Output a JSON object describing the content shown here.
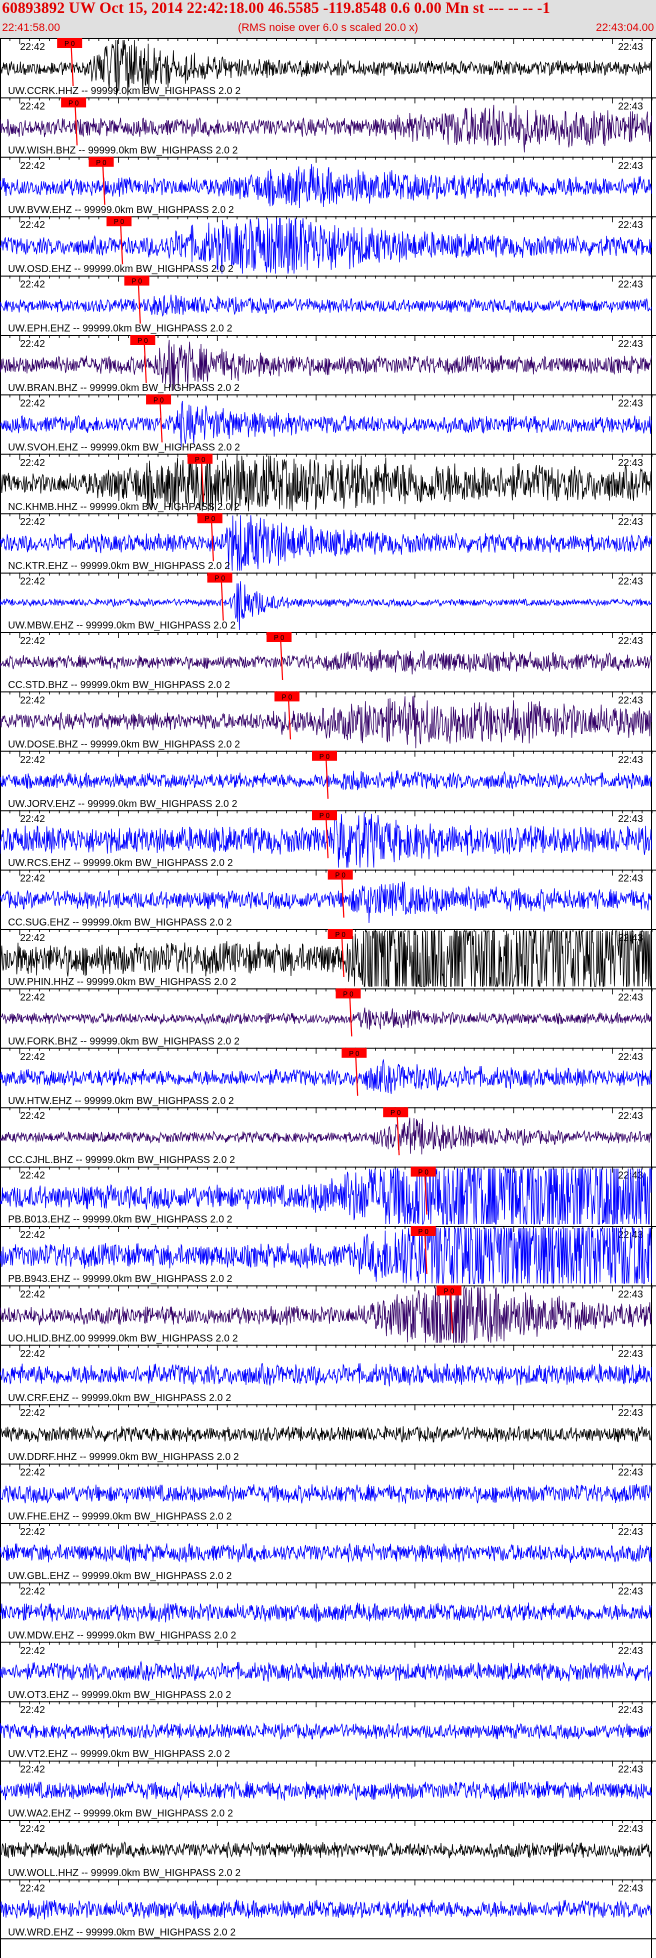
{
  "header": {
    "title": "60893892 UW Oct 15, 2014 22:42:18.00   46.5585 -119.8548  0.6 0.00 Mn st --- -- --   -1",
    "start_time": "22:41:58.00",
    "note": "(RMS noise over 6.0 s scaled 20.0 x)",
    "end_time": "22:43:04.00"
  },
  "colors": {
    "title": "#e00000",
    "header_bg": "#e0e0e0",
    "blue": "#0000ff",
    "black": "#000000",
    "indigo": "#330066",
    "pick": "#ff0000"
  },
  "chart_data": {
    "type": "line",
    "title": "60893892 UW Oct 15, 2014 22:42:18.00   46.5585 -119.8548  0.6 0.00 Mn st --- -- --   -1",
    "subtitle": "(RMS noise over 6.0 s scaled 20.0 x)",
    "x_unit": "seconds after 22:41:58.00",
    "xlim": [
      0,
      66
    ],
    "minute_labels": {
      "left": "22:42",
      "right": "22:43"
    },
    "pick_label": "P 0",
    "traces": [
      {
        "label": "UW.CCRK.HHZ -- 99999.0km BW_HIGHPASS  2.0  2",
        "color": "black",
        "pick": 7.2,
        "event_start": 8.5,
        "event_peak": 12.5,
        "event_amp": 1.0,
        "event_decay": 5.0,
        "noise": 0.25
      },
      {
        "label": "UW.WISH.BHZ -- 99999.0km BW_HIGHPASS  2.0  2",
        "color": "indigo",
        "pick": 7.6,
        "event_start": 38,
        "event_peak": 50,
        "event_amp": 0.55,
        "event_decay": 18,
        "noise": 0.3
      },
      {
        "label": "UW.BVW.EHZ -- 99999.0km BW_HIGHPASS  2.0  2",
        "color": "blue",
        "pick": 10.4,
        "event_start": 22,
        "event_peak": 30,
        "event_amp": 0.45,
        "event_decay": 14,
        "noise": 0.3
      },
      {
        "label": "UW.OSD.EHZ -- 99999.0km BW_HIGHPASS  2.0  2",
        "color": "blue",
        "pick": 12.2,
        "event_start": 14,
        "event_peak": 29,
        "event_amp": 0.95,
        "event_decay": 9,
        "noise": 0.3
      },
      {
        "label": "UW.EPH.EHZ -- 99999.0km BW_HIGHPASS  2.0  2",
        "color": "blue",
        "pick": 14.0,
        "event_start": 14.5,
        "event_peak": 16,
        "event_amp": 0.2,
        "event_decay": 6,
        "noise": 0.22
      },
      {
        "label": "UW.BRAN.BHZ -- 99999.0km BW_HIGHPASS  2.0  2",
        "color": "indigo",
        "pick": 14.6,
        "event_start": 15.5,
        "event_peak": 17,
        "event_amp": 0.75,
        "event_decay": 5,
        "noise": 0.3
      },
      {
        "label": "UW.SVOH.EHZ -- 99999.0km BW_HIGHPASS  2.0  2",
        "color": "blue",
        "pick": 16.2,
        "event_start": 17,
        "event_peak": 18.5,
        "event_amp": 0.5,
        "event_decay": 6,
        "noise": 0.28
      },
      {
        "label": "NC.KHMB.HHZ -- 99999.0km BW_HIGHPASS  2.0  2",
        "color": "black",
        "pick": 20.4,
        "event_start": 8,
        "event_peak": 22,
        "event_amp": 0.85,
        "event_decay": 30,
        "noise": 0.35
      },
      {
        "label": "NC.KTR.EHZ -- 99999.0km BW_HIGHPASS  2.0  2",
        "color": "blue",
        "pick": 21.4,
        "event_start": 22,
        "event_peak": 24,
        "event_amp": 1.0,
        "event_decay": 6,
        "noise": 0.3
      },
      {
        "label": "UW.MBW.EHZ -- 99999.0km BW_HIGHPASS  2.0  2",
        "color": "blue",
        "pick": 22.4,
        "event_start": 23.3,
        "event_peak": 24,
        "event_amp": 1.0,
        "event_decay": 2,
        "noise": 0.12
      },
      {
        "label": "CC.STD.BHZ -- 99999.0km BW_HIGHPASS  2.0  2",
        "color": "indigo",
        "pick": 28.4,
        "event_start": 30,
        "event_peak": 40,
        "event_amp": 0.2,
        "event_decay": 20,
        "noise": 0.22
      },
      {
        "label": "UW.DOSE.BHZ -- 99999.0km BW_HIGHPASS  2.0  2",
        "color": "indigo",
        "pick": 29.2,
        "event_start": 25,
        "event_peak": 42,
        "event_amp": 0.6,
        "event_decay": 25,
        "noise": 0.28
      },
      {
        "label": "UW.JORV.EHZ -- 99999.0km BW_HIGHPASS  2.0  2",
        "color": "blue",
        "pick": 33.0,
        "event_start": 34,
        "event_peak": 35,
        "event_amp": 0.2,
        "event_decay": 6,
        "noise": 0.25
      },
      {
        "label": "UW.RCS.EHZ -- 99999.0km BW_HIGHPASS  2.0  2",
        "color": "blue",
        "pick": 33.0,
        "event_start": 33.4,
        "event_peak": 34.2,
        "event_amp": 1.0,
        "event_decay": 5,
        "noise": 0.45
      },
      {
        "label": "CC.SUG.EHZ -- 99999.0km BW_HIGHPASS  2.0  2",
        "color": "blue",
        "pick": 34.6,
        "event_start": 35,
        "event_peak": 37,
        "event_amp": 0.45,
        "event_decay": 10,
        "noise": 0.3
      },
      {
        "label": "UW.PHIN.HHZ -- 99999.0km BW_HIGHPASS  2.0  2",
        "color": "black",
        "pick": 34.6,
        "event_start": 34.8,
        "event_peak": 38,
        "event_amp": 1.6,
        "event_decay": 200,
        "noise": 0.55
      },
      {
        "label": "UW.FORK.BHZ -- 99999.0km BW_HIGHPASS  2.0  2",
        "color": "indigo",
        "pick": 35.4,
        "event_start": 36,
        "event_peak": 37,
        "event_amp": 0.25,
        "event_decay": 5,
        "noise": 0.18
      },
      {
        "label": "UW.HTW.EHZ -- 99999.0km BW_HIGHPASS  2.0  2",
        "color": "blue",
        "pick": 36.0,
        "event_start": 36.5,
        "event_peak": 38,
        "event_amp": 0.3,
        "event_decay": 8,
        "noise": 0.28
      },
      {
        "label": "CC.CJHL.BHZ -- 99999.0km BW_HIGHPASS  2.0  2",
        "color": "indigo",
        "pick": 40.2,
        "event_start": 37,
        "event_peak": 42,
        "event_amp": 0.5,
        "event_decay": 6,
        "noise": 0.18
      },
      {
        "label": "PB.B013.EHZ -- 99999.0km BW_HIGHPASS  2.0  2",
        "color": "blue",
        "pick": 43.0,
        "event_start": 30,
        "event_peak": 47,
        "event_amp": 1.6,
        "event_decay": 200,
        "noise": 0.4
      },
      {
        "label": "PB.B943.EHZ -- 99999.0km BW_HIGHPASS  2.0  2",
        "color": "blue",
        "pick": 43.0,
        "event_start": 35,
        "event_peak": 46,
        "event_amp": 1.6,
        "event_decay": 200,
        "noise": 0.4
      },
      {
        "label": "UO.HLID.BHZ.00 99999.0km BW_HIGHPASS  2.0  2",
        "color": "indigo",
        "pick": 45.6,
        "event_start": 36,
        "event_peak": 46,
        "event_amp": 1.2,
        "event_decay": 8,
        "noise": 0.3
      },
      {
        "label": "UW.CRF.EHZ -- 99999.0km BW_HIGHPASS  2.0  2",
        "color": "blue",
        "pick": null,
        "noise": 0.35
      },
      {
        "label": "UW.DDRF.HHZ -- 99999.0km BW_HIGHPASS  2.0  2",
        "color": "black",
        "pick": null,
        "noise": 0.25
      },
      {
        "label": "UW.FHE.EHZ -- 99999.0km BW_HIGHPASS  2.0  2",
        "color": "blue",
        "pick": null,
        "noise": 0.3
      },
      {
        "label": "UW.GBL.EHZ -- 99999.0km BW_HIGHPASS  2.0  2",
        "color": "blue",
        "pick": null,
        "noise": 0.3
      },
      {
        "label": "UW.MDW.EHZ -- 99999.0km BW_HIGHPASS  2.0  2",
        "color": "blue",
        "pick": null,
        "noise": 0.3
      },
      {
        "label": "UW.OT3.EHZ -- 99999.0km BW_HIGHPASS  2.0  2",
        "color": "blue",
        "pick": null,
        "noise": 0.3
      },
      {
        "label": "UW.VT2.EHZ -- 99999.0km BW_HIGHPASS  2.0  2",
        "color": "blue",
        "pick": null,
        "noise": 0.25
      },
      {
        "label": "UW.WA2.EHZ -- 99999.0km BW_HIGHPASS  2.0  2",
        "color": "blue",
        "pick": null,
        "noise": 0.3
      },
      {
        "label": "UW.WOLL.HHZ -- 99999.0km BW_HIGHPASS  2.0  2",
        "color": "black",
        "pick": null,
        "noise": 0.25
      },
      {
        "label": "UW.WRD.EHZ -- 99999.0km BW_HIGHPASS  2.0  2",
        "color": "blue",
        "pick": null,
        "noise": 0.3
      }
    ]
  }
}
